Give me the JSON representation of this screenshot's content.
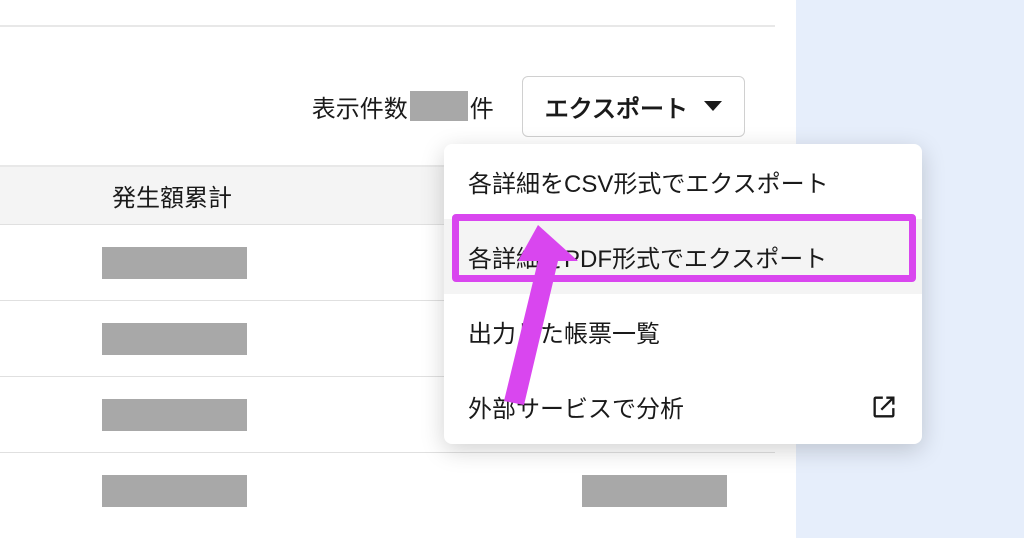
{
  "toolbar": {
    "display_count_prefix": "表示件数",
    "display_count_suffix": "件",
    "export_label": "エクスポート"
  },
  "table": {
    "header_label": "発生額累計"
  },
  "dropdown": {
    "items": [
      {
        "label": "各詳細をCSV形式でエクスポート",
        "external": false,
        "highlighted": false
      },
      {
        "label": "各詳細をPDF形式でエクスポート",
        "external": false,
        "highlighted": true
      },
      {
        "label": "出力した帳票一覧",
        "external": false,
        "highlighted": false
      },
      {
        "label": "外部サービスで分析",
        "external": true,
        "highlighted": false
      }
    ]
  },
  "annotation": {
    "highlight_color": "#d946ef"
  }
}
